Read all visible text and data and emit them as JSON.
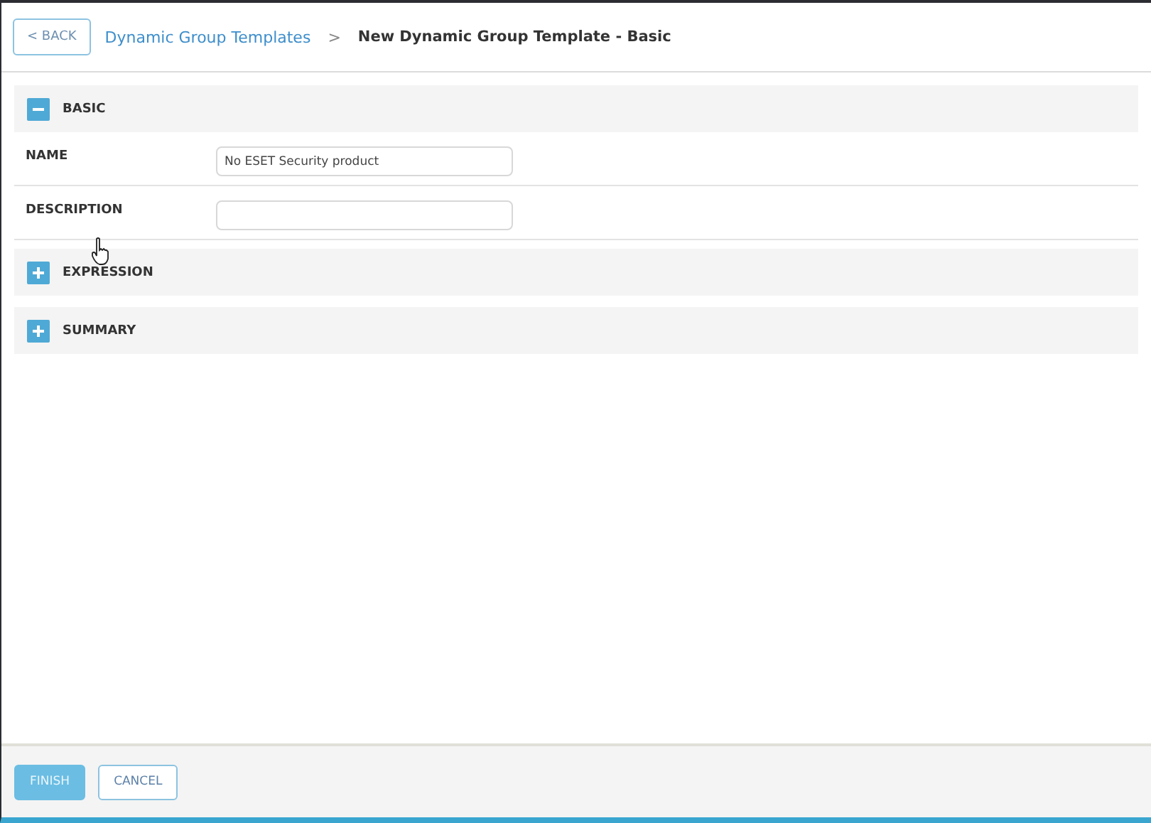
{
  "header": {
    "back_button": "< BACK",
    "breadcrumb": [
      {
        "label": "Dynamic Group Templates",
        "link": true
      },
      {
        "label": "New Dynamic Group Template - Basic",
        "link": false
      }
    ],
    "separator": ">"
  },
  "sections": [
    {
      "title": "BASIC",
      "expanded": true,
      "fields": [
        {
          "label": "NAME",
          "value": "No ESET Security product"
        },
        {
          "label": "DESCRIPTION"
        }
      ]
    },
    {
      "title": "EXPRESSION",
      "expanded": false
    },
    {
      "title": "SUMMARY",
      "expanded": false
    }
  ],
  "footer": {
    "buttons": [
      {
        "label": "FINISH",
        "kind": "primary"
      },
      {
        "label": "CANCEL",
        "kind": "secondary"
      }
    ]
  }
}
